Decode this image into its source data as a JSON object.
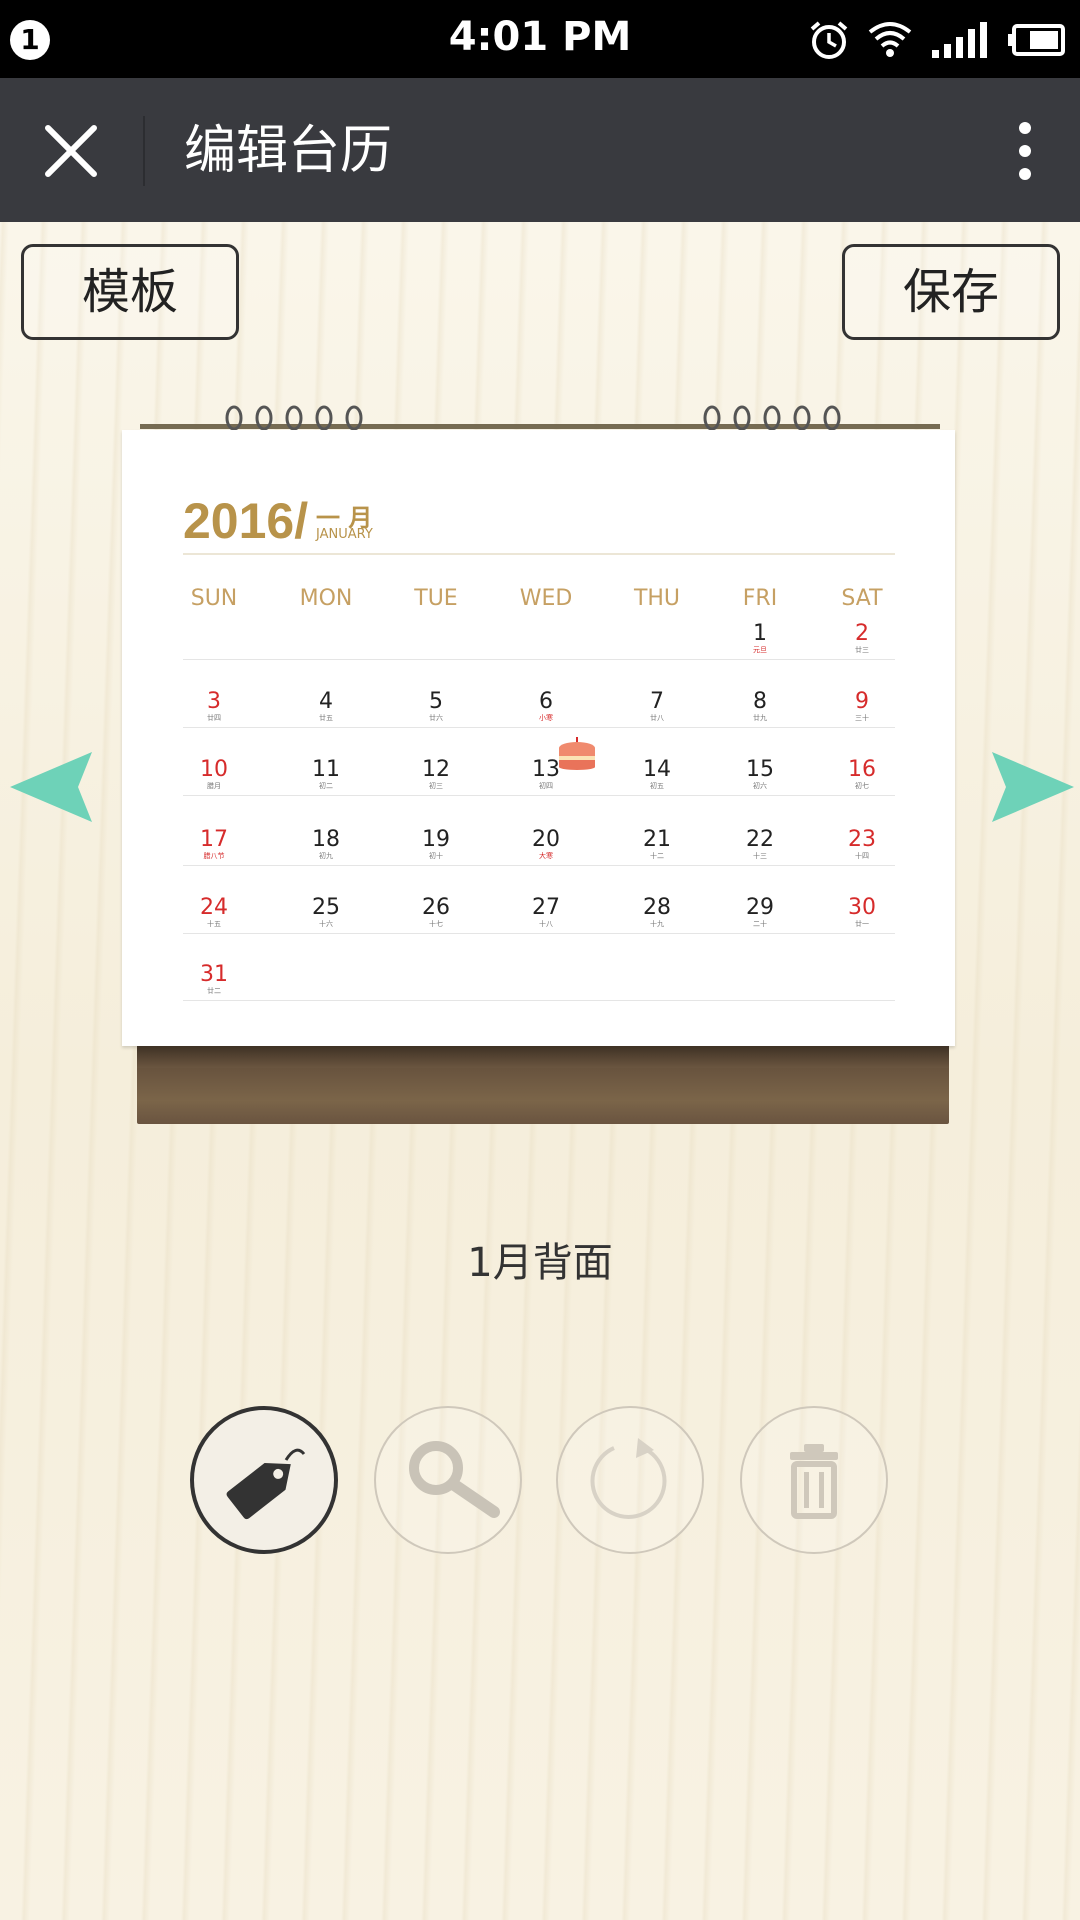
{
  "status_bar": {
    "notification_count": "1",
    "time": "4:01 PM",
    "icons": [
      "alarm-icon",
      "wifi-icon",
      "signal-icon",
      "battery-icon"
    ]
  },
  "app_bar": {
    "title": "编辑台历",
    "close_icon": "close-icon",
    "more_icon": "more-vertical-icon"
  },
  "buttons": {
    "template": "模板",
    "save": "保存"
  },
  "calendar": {
    "year": "2016/",
    "month_cn": "一 月",
    "month_en": "JANUARY",
    "weekdays": [
      "SUN",
      "MON",
      "TUE",
      "WED",
      "THU",
      "FRI",
      "SAT"
    ],
    "weeks": [
      [
        null,
        null,
        null,
        null,
        null,
        {
          "d": "1",
          "s": "元旦",
          "r": true
        },
        {
          "d": "2",
          "s": "廿三"
        }
      ],
      [
        {
          "d": "3",
          "s": "廿四"
        },
        {
          "d": "4",
          "s": "廿五"
        },
        {
          "d": "5",
          "s": "廿六"
        },
        {
          "d": "6",
          "s": "小寒",
          "r": true
        },
        {
          "d": "7",
          "s": "廿八"
        },
        {
          "d": "8",
          "s": "廿九"
        },
        {
          "d": "9",
          "s": "三十"
        }
      ],
      [
        {
          "d": "10",
          "s": "腊月"
        },
        {
          "d": "11",
          "s": "初二"
        },
        {
          "d": "12",
          "s": "初三"
        },
        {
          "d": "13",
          "s": "初四"
        },
        {
          "d": "14",
          "s": "初五"
        },
        {
          "d": "15",
          "s": "初六"
        },
        {
          "d": "16",
          "s": "初七"
        }
      ],
      [
        {
          "d": "17",
          "s": "腊八节",
          "r": true
        },
        {
          "d": "18",
          "s": "初九"
        },
        {
          "d": "19",
          "s": "初十"
        },
        {
          "d": "20",
          "s": "大寒",
          "r": true
        },
        {
          "d": "21",
          "s": "十二"
        },
        {
          "d": "22",
          "s": "十三"
        },
        {
          "d": "23",
          "s": "十四"
        }
      ],
      [
        {
          "d": "24",
          "s": "十五"
        },
        {
          "d": "25",
          "s": "十六"
        },
        {
          "d": "26",
          "s": "十七"
        },
        {
          "d": "27",
          "s": "十八"
        },
        {
          "d": "28",
          "s": "十九"
        },
        {
          "d": "29",
          "s": "二十"
        },
        {
          "d": "30",
          "s": "廿一"
        }
      ],
      [
        {
          "d": "31",
          "s": "廿二"
        },
        null,
        null,
        null,
        null,
        null,
        null
      ]
    ],
    "sticker": "cake-icon"
  },
  "navigation": {
    "prev_icon": "arrow-left-icon",
    "next_icon": "arrow-right-icon"
  },
  "page_label": "1月背面",
  "tools": [
    {
      "icon": "tag-icon",
      "active": true
    },
    {
      "icon": "zoom-icon",
      "active": false
    },
    {
      "icon": "rotate-icon",
      "active": false
    },
    {
      "icon": "trash-icon",
      "active": false
    }
  ],
  "colors": {
    "app_bar": "#393a3f",
    "accent_gold": "#b8934a",
    "weekend_red": "#d62b2b",
    "arrow_teal": "#6ed2b8"
  }
}
